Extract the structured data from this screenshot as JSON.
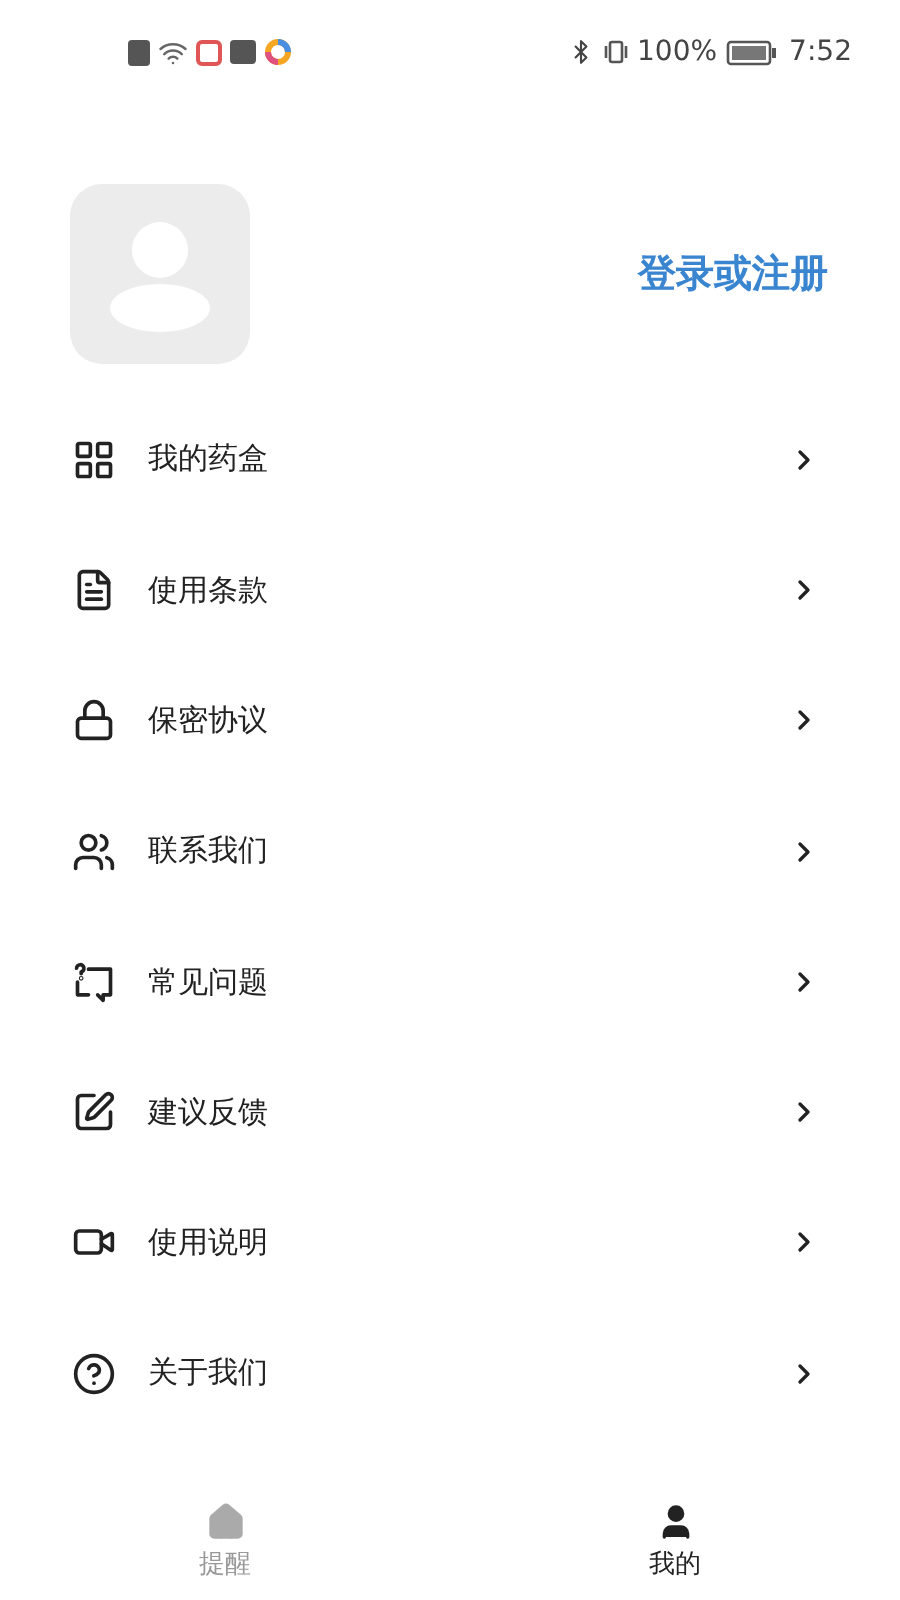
{
  "status_bar": {
    "battery": "100%",
    "time": "7:52"
  },
  "profile": {
    "login_link": "登录或注册"
  },
  "menu": [
    {
      "kind": "grid",
      "label": "我的药盒"
    },
    {
      "kind": "document",
      "label": "使用条款"
    },
    {
      "kind": "lock",
      "label": "保密协议"
    },
    {
      "kind": "users",
      "label": "联系我们"
    },
    {
      "kind": "question-bubble",
      "label": "常见问题"
    },
    {
      "kind": "edit",
      "label": "建议反馈"
    },
    {
      "kind": "video",
      "label": "使用说明"
    },
    {
      "kind": "help",
      "label": "关于我们"
    }
  ],
  "bottom_nav": [
    {
      "kind": "home",
      "label": "提醒",
      "selected": false
    },
    {
      "kind": "user",
      "label": "我的",
      "selected": true
    }
  ]
}
